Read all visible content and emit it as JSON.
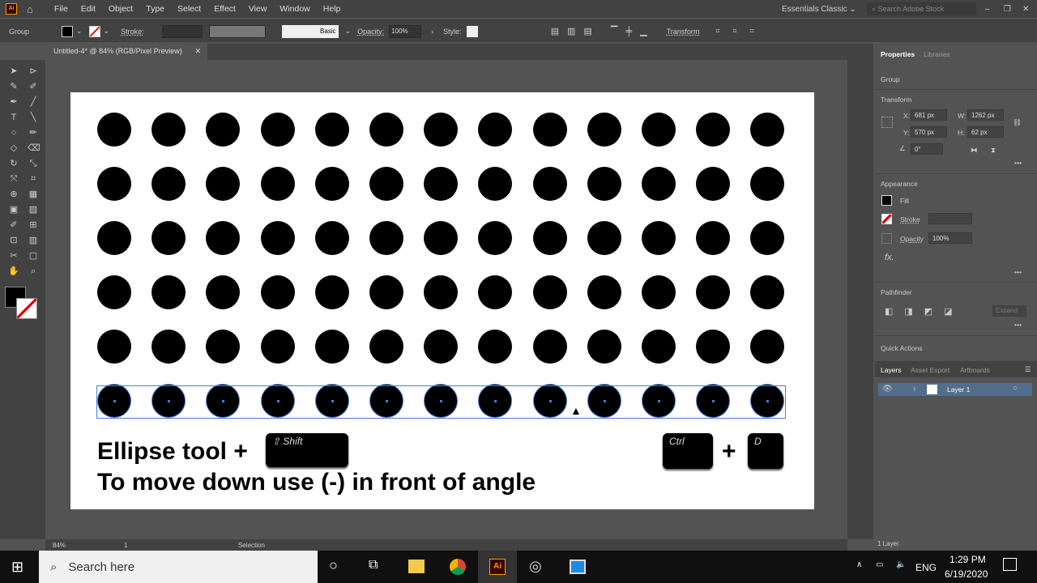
{
  "app": {
    "logo": "Ai",
    "home_icon": "home-icon"
  },
  "menu": [
    "File",
    "Edit",
    "Object",
    "Type",
    "Select",
    "Effect",
    "View",
    "Window",
    "Help"
  ],
  "workspace": "Essentials Classic",
  "stock_search_placeholder": "Search Adobe Stock",
  "control": {
    "selection_type": "Group",
    "stroke_label": "Stroke:",
    "brush": "Basic",
    "opacity_label": "Opacity:",
    "opacity": "100%",
    "style_label": "Style:",
    "transform_label": "Transform"
  },
  "document_tab": {
    "title": "Untitled-4* @ 84% (RGB/Pixel Preview)"
  },
  "canvas": {
    "rows": 6,
    "cols": 13,
    "selected_row": 6,
    "line1": "Ellipse tool  +",
    "shift_key": "⇧ Shift",
    "ctrl_key": "Ctrl",
    "plus": "+",
    "d_key": "D",
    "line2": "To move down use (-) in front of angle"
  },
  "properties": {
    "tabs": [
      "Properties",
      "Libraries"
    ],
    "selection": "Group",
    "transform_title": "Transform",
    "x_label": "X:",
    "x": "681 px",
    "y_label": "Y:",
    "y": "570 px",
    "w_label": "W:",
    "w": "1262 px",
    "h_label": "H:",
    "h": "62 px",
    "angle": "0°",
    "appearance_title": "Appearance",
    "fill_label": "Fill",
    "stroke_label": "Stroke",
    "opacity_label": "Opacity",
    "opacity": "100%",
    "fx": "fx.",
    "pathfinder_title": "Pathfinder",
    "expand": "Expand",
    "quick_actions_title": "Quick Actions",
    "more": "•••"
  },
  "layers": {
    "tabs": [
      "Layers",
      "Asset Export",
      "Artboards"
    ],
    "items": [
      {
        "name": "Layer 1"
      }
    ],
    "count": "1 Layer"
  },
  "status": {
    "zoom": "84%",
    "artboard": "1",
    "tool": "Selection"
  },
  "taskbar": {
    "search_placeholder": "Search here",
    "lang": "ENG",
    "time": "1:29 PM",
    "date": "6/19/2020"
  },
  "colors": {
    "accent": "#4a7cd6",
    "ui_dark": "#424242",
    "ui_mid": "#535353"
  }
}
